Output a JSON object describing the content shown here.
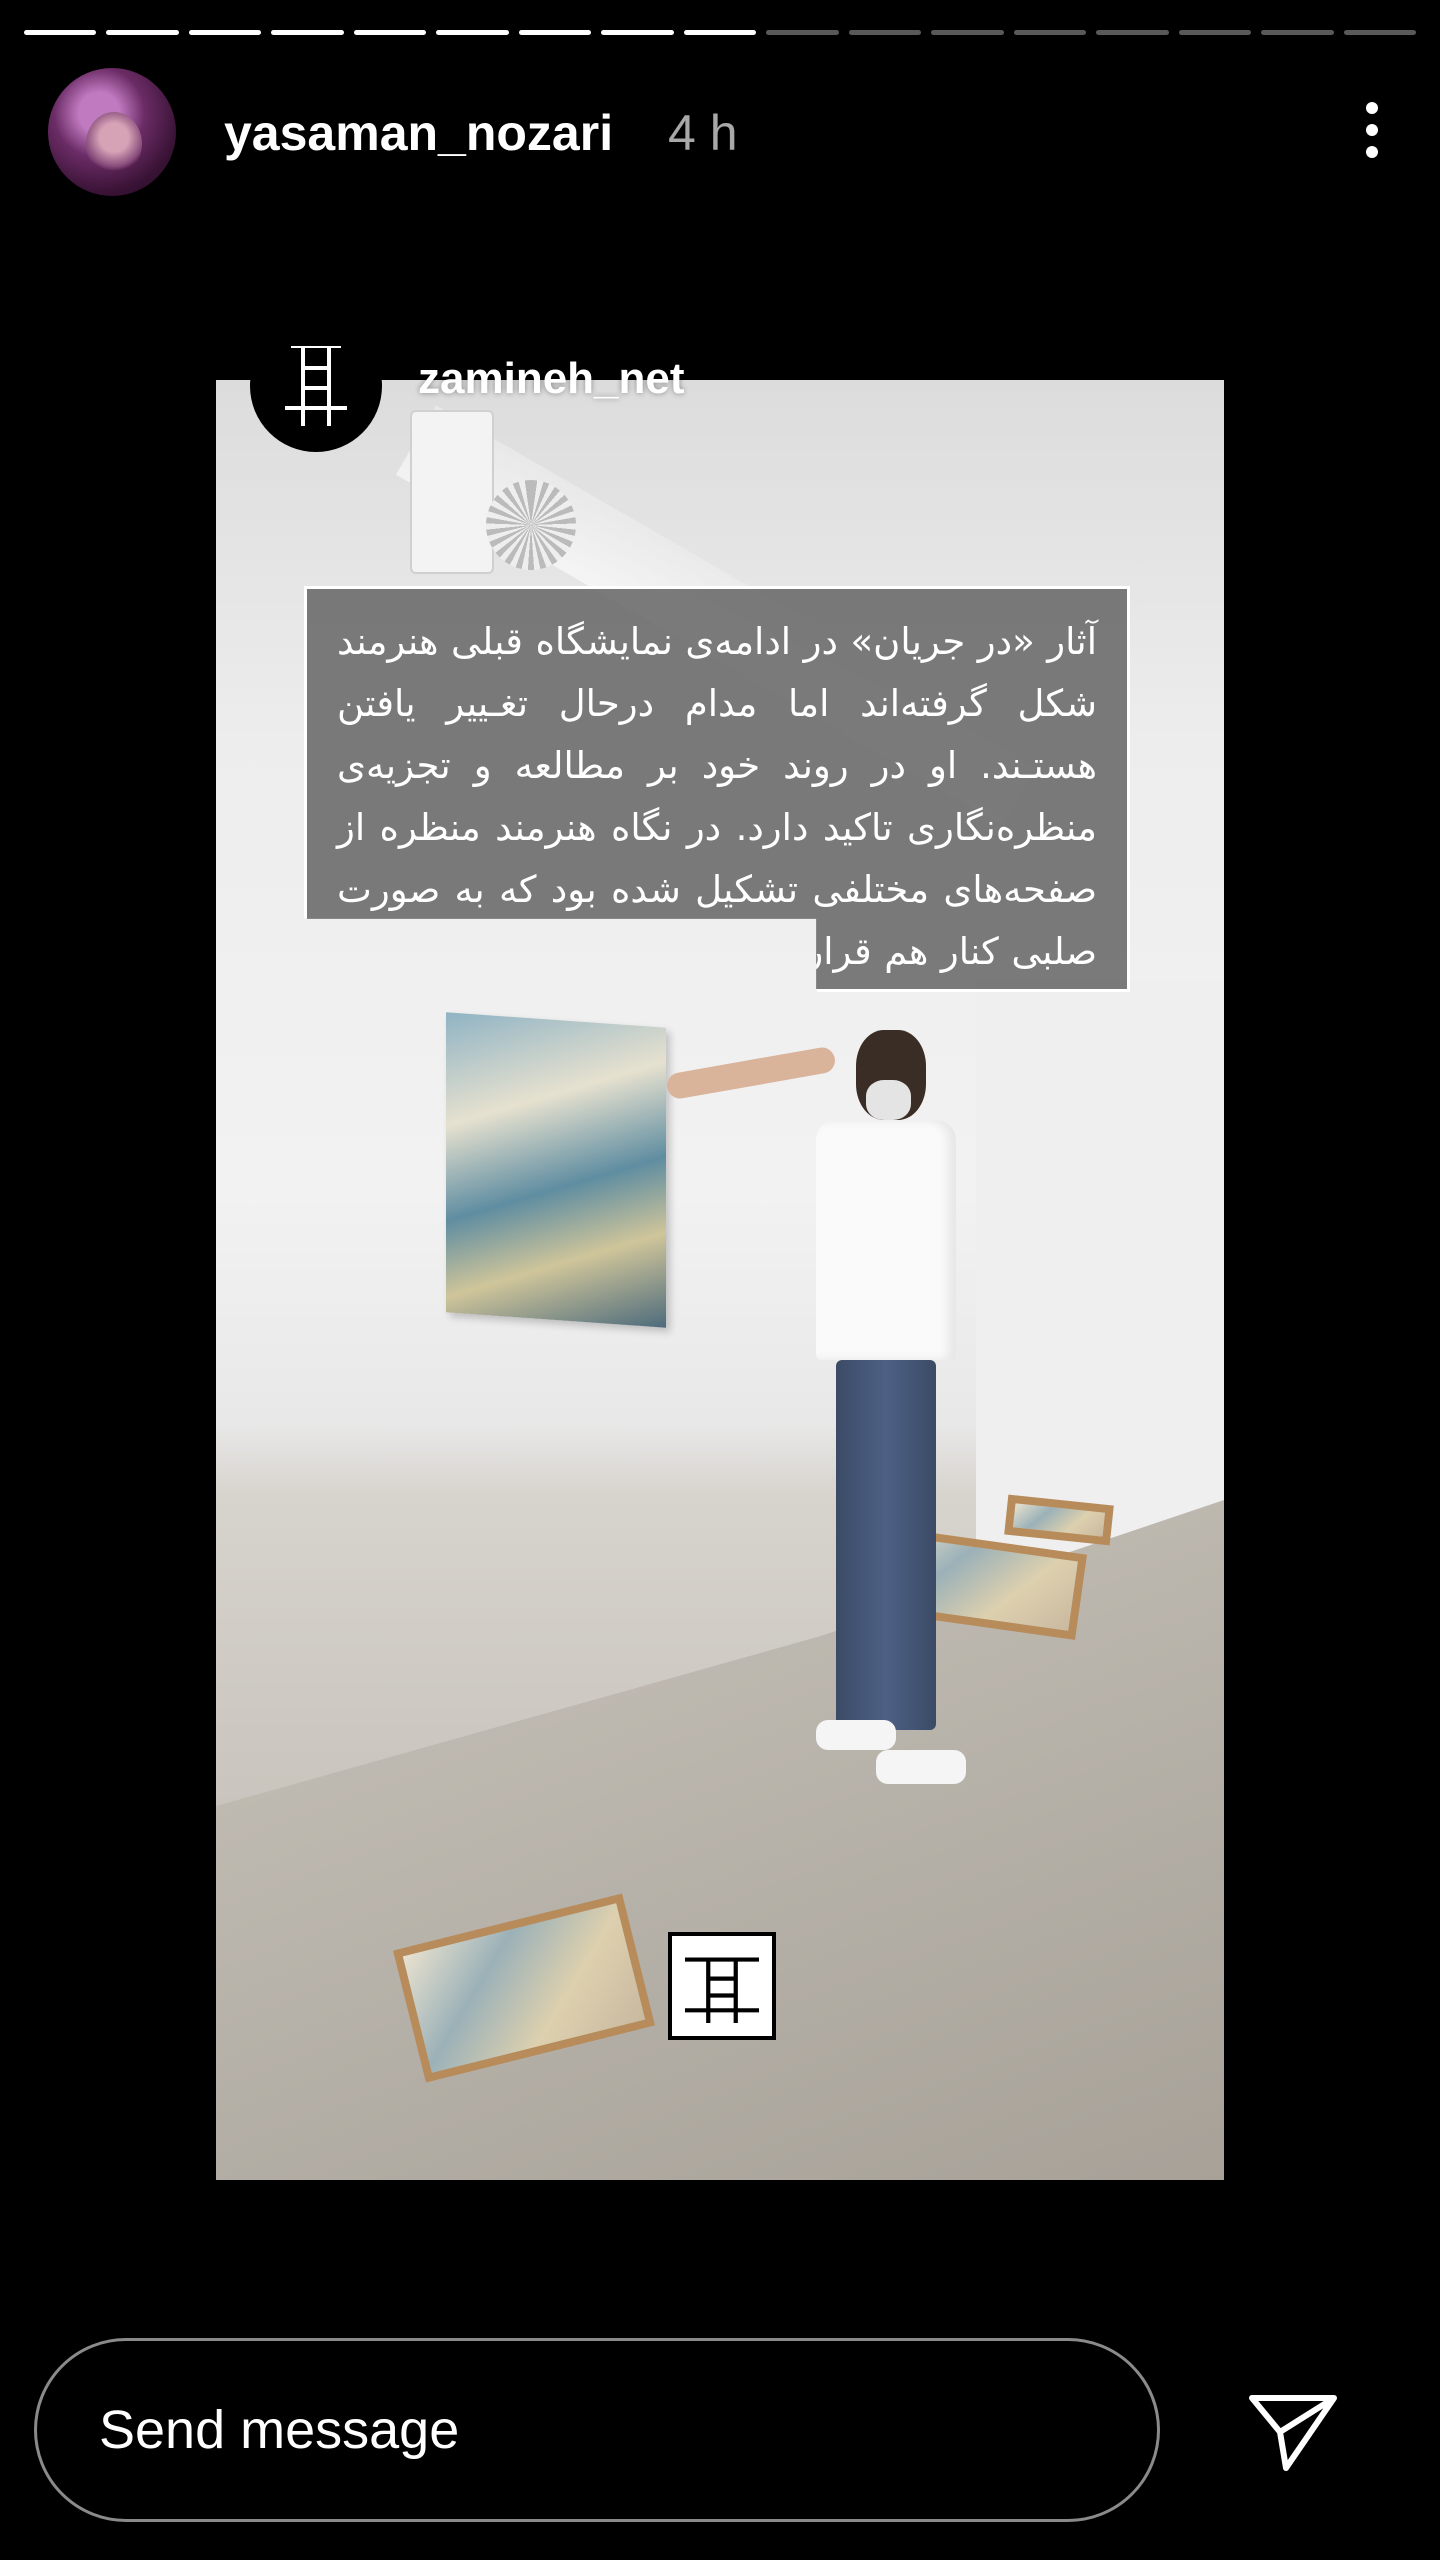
{
  "progress": {
    "total_segments": 17,
    "completed_segments": 9
  },
  "header": {
    "username": "yasaman_nozari",
    "time": "4 h",
    "avatar_icon": "profile-avatar",
    "more_icon": "vertical-dots-icon"
  },
  "story": {
    "source_account": "zamineh_net",
    "source_logo_icon": "ladder-logo-icon",
    "caption": "آثار «در جریان» در ادامه‌ی نمایشگاه قبلی هنرمند شکل گرفته‌اند اما مدام درحال تغـییر یافتن هستـند. او در روند خود بر مطالعه و تجزیه‌ی منظره‌نگاری تاکید دارد. در نگاه هنرمند منظره از صفحه‌های مختلفی تشکیل شده بود که به صورت صلبی کنار هم قرار گرفته بودند و او سعی می‌کرد تا آن‌ها را با یکدیگر یکسان کند."
  },
  "footer": {
    "message_placeholder": "Send message",
    "send_icon": "paper-plane-icon"
  }
}
